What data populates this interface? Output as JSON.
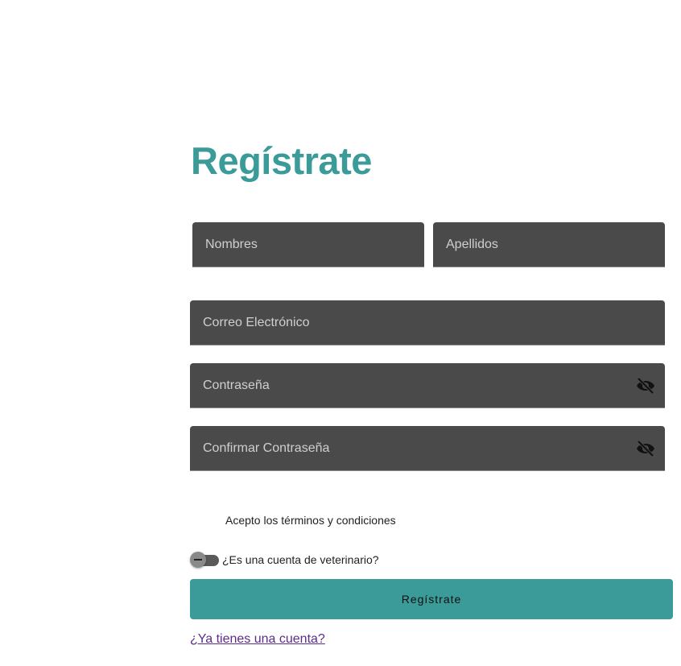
{
  "form": {
    "title": "Regístrate",
    "fields": {
      "nombres": {
        "placeholder": "Nombres"
      },
      "apellidos": {
        "placeholder": "Apellidos"
      },
      "correo": {
        "placeholder": "Correo Electrónico"
      },
      "password": {
        "placeholder": "Contraseña",
        "icon": "eye-off-icon"
      },
      "confirm_password": {
        "placeholder": "Confirmar Contraseña",
        "icon": "eye-off-icon"
      }
    },
    "terms_label": "Acepto los términos y condiciones",
    "vet_toggle": {
      "label": "¿Es una cuenta de veterinario?",
      "checked": false
    },
    "submit_label": "Regístrate",
    "login_link": "¿Ya tienes una cuenta?"
  },
  "colors": {
    "accent": "#3a9b98",
    "field_bg": "#4a4a4a",
    "link": "#5b2c8a"
  }
}
